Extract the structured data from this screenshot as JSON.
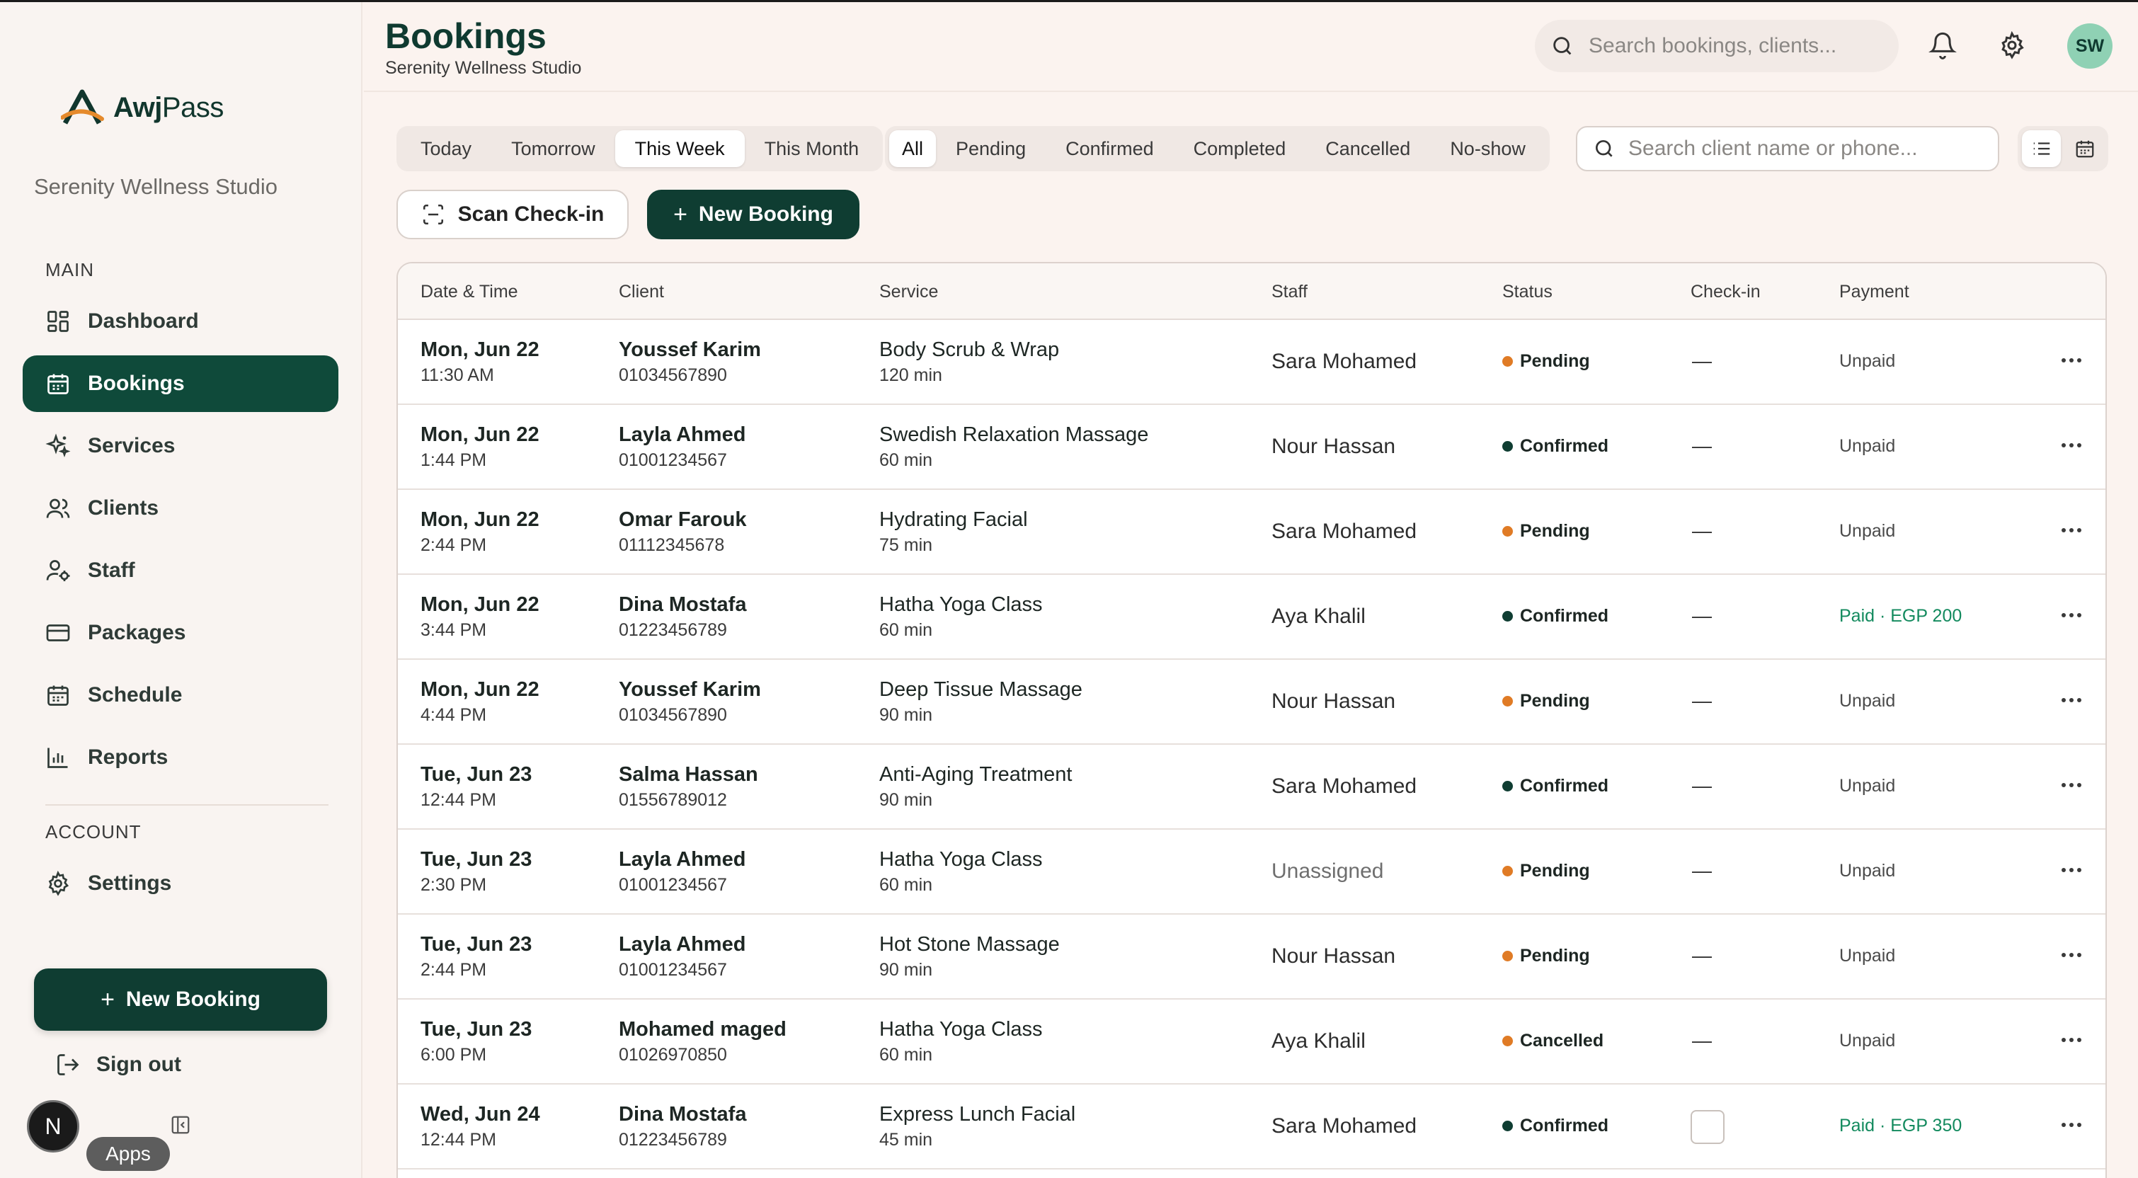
{
  "app": {
    "brand_prefix": "Awj",
    "brand_suffix": "Pass",
    "org_name": "Serenity Wellness Studio"
  },
  "sidebar": {
    "section_main": "MAIN",
    "section_account": "ACCOUNT",
    "items": [
      {
        "label": "Dashboard",
        "icon": "dashboard-icon"
      },
      {
        "label": "Bookings",
        "icon": "calendar-icon",
        "active": true
      },
      {
        "label": "Services",
        "icon": "sparkles-icon"
      },
      {
        "label": "Clients",
        "icon": "users-icon"
      },
      {
        "label": "Staff",
        "icon": "user-cog-icon"
      },
      {
        "label": "Packages",
        "icon": "card-icon"
      },
      {
        "label": "Schedule",
        "icon": "calendar-icon"
      },
      {
        "label": "Reports",
        "icon": "bar-chart-icon"
      }
    ],
    "settings_label": "Settings",
    "new_booking_label": "New Booking",
    "sign_out_label": "Sign out",
    "user_initial": "N",
    "apps_tooltip": "Apps"
  },
  "header": {
    "title": "Bookings",
    "subtitle": "Serenity Wellness Studio",
    "search_placeholder": "Search bookings, clients...",
    "avatar_initials": "SW"
  },
  "filters": {
    "date_range": [
      "Today",
      "Tomorrow",
      "This Week",
      "This Month"
    ],
    "date_selected": "This Week",
    "status": [
      "All",
      "Pending",
      "Confirmed",
      "Completed",
      "Cancelled",
      "No-show"
    ],
    "status_selected": "All",
    "search_placeholder": "Search client name or phone...",
    "view_selected": "list"
  },
  "actions": {
    "scan_label": "Scan Check-in",
    "new_booking_label": "New Booking"
  },
  "colors": {
    "primary": "#0f4a3a",
    "pending": "#e07b25",
    "confirmed": "#0f3d32",
    "cancelled": "#e07b25",
    "paid": "#138a5e"
  },
  "table": {
    "columns": [
      "Date & Time",
      "Client",
      "Service",
      "Staff",
      "Status",
      "Check-in",
      "Payment"
    ],
    "rows": [
      {
        "date": "Mon, Jun 22",
        "time": "11:30 AM",
        "client": "Youssef Karim",
        "phone": "01034567890",
        "service": "Body Scrub & Wrap",
        "duration": "120 min",
        "staff": "Sara Mohamed",
        "status": "Pending",
        "checkin": "—",
        "payment": "Unpaid"
      },
      {
        "date": "Mon, Jun 22",
        "time": "1:44 PM",
        "client": "Layla Ahmed",
        "phone": "01001234567",
        "service": "Swedish Relaxation Massage",
        "duration": "60 min",
        "staff": "Nour Hassan",
        "status": "Confirmed",
        "checkin": "—",
        "payment": "Unpaid"
      },
      {
        "date": "Mon, Jun 22",
        "time": "2:44 PM",
        "client": "Omar Farouk",
        "phone": "01112345678",
        "service": "Hydrating Facial",
        "duration": "75 min",
        "staff": "Sara Mohamed",
        "status": "Pending",
        "checkin": "—",
        "payment": "Unpaid"
      },
      {
        "date": "Mon, Jun 22",
        "time": "3:44 PM",
        "client": "Dina Mostafa",
        "phone": "01223456789",
        "service": "Hatha Yoga Class",
        "duration": "60 min",
        "staff": "Aya Khalil",
        "status": "Confirmed",
        "checkin": "—",
        "payment": "Paid · EGP 200"
      },
      {
        "date": "Mon, Jun 22",
        "time": "4:44 PM",
        "client": "Youssef Karim",
        "phone": "01034567890",
        "service": "Deep Tissue Massage",
        "duration": "90 min",
        "staff": "Nour Hassan",
        "status": "Pending",
        "checkin": "—",
        "payment": "Unpaid"
      },
      {
        "date": "Tue, Jun 23",
        "time": "12:44 PM",
        "client": "Salma Hassan",
        "phone": "01556789012",
        "service": "Anti-Aging Treatment",
        "duration": "90 min",
        "staff": "Sara Mohamed",
        "status": "Confirmed",
        "checkin": "—",
        "payment": "Unpaid"
      },
      {
        "date": "Tue, Jun 23",
        "time": "2:30 PM",
        "client": "Layla Ahmed",
        "phone": "01001234567",
        "service": "Hatha Yoga Class",
        "duration": "60 min",
        "staff": "Unassigned",
        "status": "Pending",
        "checkin": "—",
        "payment": "Unpaid"
      },
      {
        "date": "Tue, Jun 23",
        "time": "2:44 PM",
        "client": "Layla Ahmed",
        "phone": "01001234567",
        "service": "Hot Stone Massage",
        "duration": "90 min",
        "staff": "Nour Hassan",
        "status": "Pending",
        "checkin": "—",
        "payment": "Unpaid"
      },
      {
        "date": "Tue, Jun 23",
        "time": "6:00 PM",
        "client": "Mohamed maged",
        "phone": "01026970850",
        "service": "Hatha Yoga Class",
        "duration": "60 min",
        "staff": "Aya Khalil",
        "status": "Cancelled",
        "checkin": "—",
        "payment": "Unpaid"
      },
      {
        "date": "Wed, Jun 24",
        "time": "12:44 PM",
        "client": "Dina Mostafa",
        "phone": "01223456789",
        "service": "Express Lunch Facial",
        "duration": "45 min",
        "staff": "Sara Mohamed",
        "status": "Confirmed",
        "checkin": "checkbox",
        "payment": "Paid · EGP 350"
      }
    ]
  }
}
